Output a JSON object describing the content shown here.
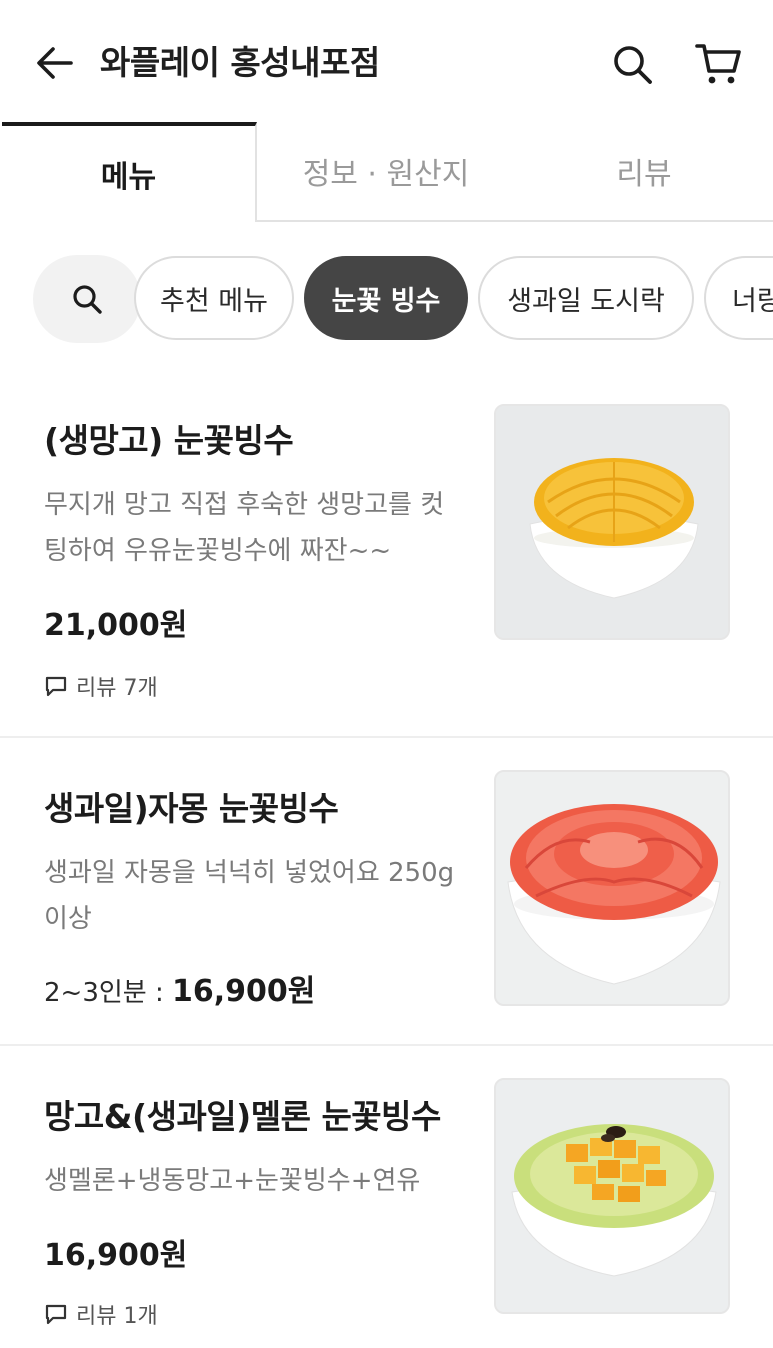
{
  "header": {
    "title": "와플레이 홍성내포점",
    "back_icon": "arrow-left-icon",
    "search_icon": "search-icon",
    "cart_icon": "cart-icon"
  },
  "tabs": [
    {
      "label": "메뉴",
      "active": true
    },
    {
      "label": "정보 · 원산지",
      "active": false
    },
    {
      "label": "리뷰",
      "active": false
    }
  ],
  "categories": [
    {
      "label": "추천 메뉴",
      "active": false
    },
    {
      "label": "눈꽃 빙수",
      "active": true
    },
    {
      "label": "생과일 도시락",
      "active": false
    },
    {
      "label": "너랑",
      "active": false
    }
  ],
  "menu_items": [
    {
      "name": "(생망고) 눈꽃빙수",
      "desc": "무지개 망고 직접 후숙한 생망고를 컷팅하여 우유눈꽃빙수에 짜잔~~",
      "price_prefix": "",
      "price": "21,000원",
      "review": "리뷰 7개"
    },
    {
      "name": "생과일)자몽 눈꽃빙수",
      "desc": "생과일 자몽을 넉넉히 넣었어요 250g이상",
      "price_prefix": "2~3인분 : ",
      "price": "16,900원",
      "review": ""
    },
    {
      "name": "망고&(생과일)멜론 눈꽃빙수",
      "desc": "생멜론+냉동망고+눈꽃빙수+연유",
      "price_prefix": "",
      "price": "16,900원",
      "review": "리뷰 1개"
    }
  ],
  "colors": {
    "active_chip": "#454545",
    "tab_indicator": "#1a1a1a",
    "muted_text": "#7a7a7a"
  }
}
